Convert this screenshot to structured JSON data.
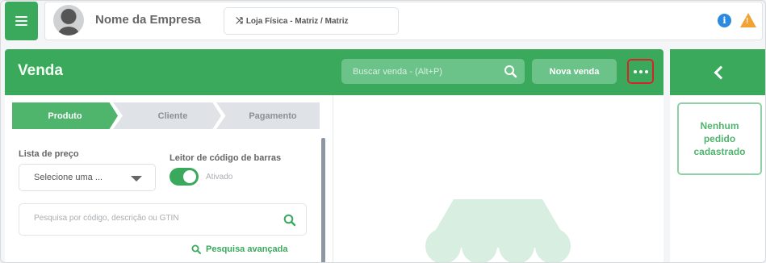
{
  "topbar": {
    "menu_icon": "hamburger-icon",
    "company_name": "Nome da Empresa",
    "store_icon": "shuffle-icon",
    "store_label": "Loja Física - Matriz / Matriz",
    "info_icon": "info-icon",
    "warning_icon": "warning-icon"
  },
  "sale_panel": {
    "title": "Venda",
    "search_placeholder": "Buscar venda - (Alt+P)",
    "new_sale_label": "Nova venda",
    "more_icon": "more-dots-icon",
    "accent_color": "#3aa95c",
    "highlight_color": "#d9232a"
  },
  "steps": [
    {
      "label": "Produto",
      "active": true
    },
    {
      "label": "Cliente",
      "active": false
    },
    {
      "label": "Pagamento",
      "active": false
    }
  ],
  "form": {
    "price_list_label": "Lista de preço",
    "price_list_value": "Selecione uma ...",
    "barcode_label": "Leitor de código de barras",
    "barcode_toggle_state": "Ativado",
    "product_search_placeholder": "Pesquisa por código, descrição ou GTIN",
    "advanced_search_label": "Pesquisa avançada"
  },
  "side_panel": {
    "back_icon": "chevron-left-icon",
    "empty_message": "Nenhum pedido cadastrado"
  }
}
